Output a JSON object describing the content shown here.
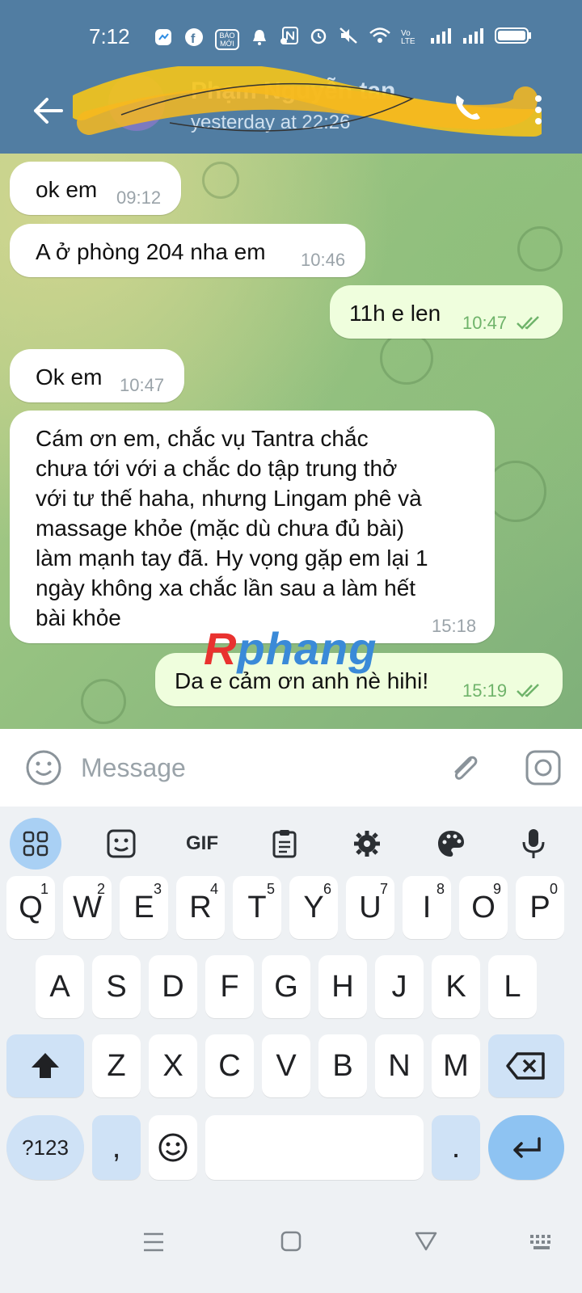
{
  "status_bar": {
    "time": "7:12",
    "notification_icons": [
      "messenger-icon",
      "facebook-icon",
      "baomoi-icon",
      "bell-icon",
      "dot-icon"
    ],
    "baomoi_text": "BÁO MỚI",
    "system_icons": [
      "nfc-icon",
      "alarm-icon",
      "mute-icon",
      "wifi-icon",
      "volte-icon",
      "signal-icon",
      "battery-icon"
    ],
    "volte_text": "Vo LTE"
  },
  "header": {
    "contact_name": "Phạm Nguyễn tan",
    "last_seen": "yesterday at 22:26"
  },
  "messages": [
    {
      "text": "ok em",
      "time": "09:12",
      "direction": "in"
    },
    {
      "text": "A ở phòng 204 nha em",
      "time": "10:46",
      "direction": "in"
    },
    {
      "text": "11h e len",
      "time": "10:47",
      "direction": "out",
      "status": "read"
    },
    {
      "text": "Ok em",
      "time": "10:47",
      "direction": "in"
    },
    {
      "lines": [
        "Cám ơn em, chắc vụ Tantra chắc",
        "chưa tới với a chắc do tập trung thở",
        "với tư thế haha, nhưng Lingam phê và",
        "massage khỏe (mặc dù chưa đủ bài)",
        "làm mạnh tay đã. Hy vọng gặp em lại 1",
        "ngày không xa chắc lần sau a làm hết",
        "bài khỏe"
      ],
      "time": "15:18",
      "direction": "in"
    },
    {
      "text": "Da e cảm ơn anh nè hihi!",
      "time": "15:19",
      "direction": "out",
      "status": "read"
    }
  ],
  "watermark": {
    "part1": "R",
    "part2": "phang"
  },
  "composer": {
    "placeholder": "Message"
  },
  "keyboard": {
    "toolbar": {
      "gif": "GIF"
    },
    "row1": [
      {
        "k": "Q",
        "n": "1"
      },
      {
        "k": "W",
        "n": "2"
      },
      {
        "k": "E",
        "n": "3"
      },
      {
        "k": "R",
        "n": "4"
      },
      {
        "k": "T",
        "n": "5"
      },
      {
        "k": "Y",
        "n": "6"
      },
      {
        "k": "U",
        "n": "7"
      },
      {
        "k": "I",
        "n": "8"
      },
      {
        "k": "O",
        "n": "9"
      },
      {
        "k": "P",
        "n": "0"
      }
    ],
    "row2": [
      "A",
      "S",
      "D",
      "F",
      "G",
      "H",
      "J",
      "K",
      "L"
    ],
    "row3": [
      "Z",
      "X",
      "C",
      "V",
      "B",
      "N",
      "M"
    ],
    "symbols": "?123",
    "comma": ",",
    "period": "."
  },
  "colors": {
    "header": "#517da2",
    "outgoing": "#effedd",
    "incoming": "#ffffff",
    "accent": "#3a8ad8"
  }
}
